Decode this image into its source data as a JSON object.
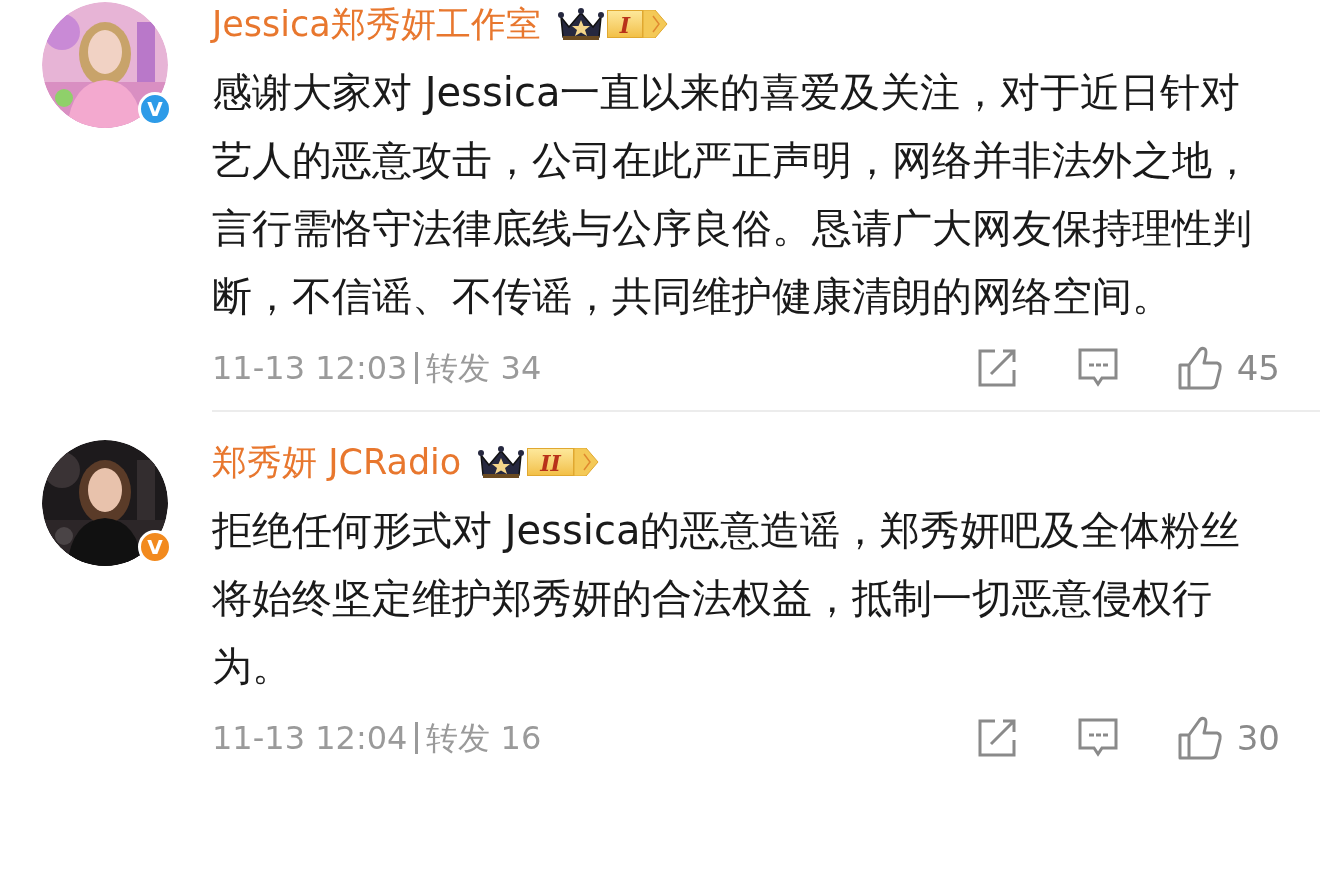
{
  "comments": [
    {
      "author": "Jessica郑秀妍工作室",
      "level": "I",
      "verified": {
        "mark": "V",
        "color": "#2d9be8"
      },
      "text": "感谢大家对 Jessica一直以来的喜爱及关注，对于近日针对艺人的恶意攻击，公司在此严正声明，网络并非法外之地，言行需恪守法律底线与公序良俗。恳请广大网友保持理性判断，不信谣、不传谣，共同维护健康清朗的网络空间。",
      "time": "11-13 12:03",
      "repost_label": "转发",
      "repost_count": "34",
      "likes": "45"
    },
    {
      "author": "郑秀妍 JCRadio",
      "level": "II",
      "verified": {
        "mark": "V",
        "color": "#f28a1e"
      },
      "text": "拒绝任何形式对 Jessica的恶意造谣，郑秀妍吧及全体粉丝将始终坚定维护郑秀妍的合法权益，抵制一切恶意侵权行为。",
      "time": "11-13 12:04",
      "repost_label": "转发",
      "repost_count": "16",
      "likes": "30"
    }
  ]
}
